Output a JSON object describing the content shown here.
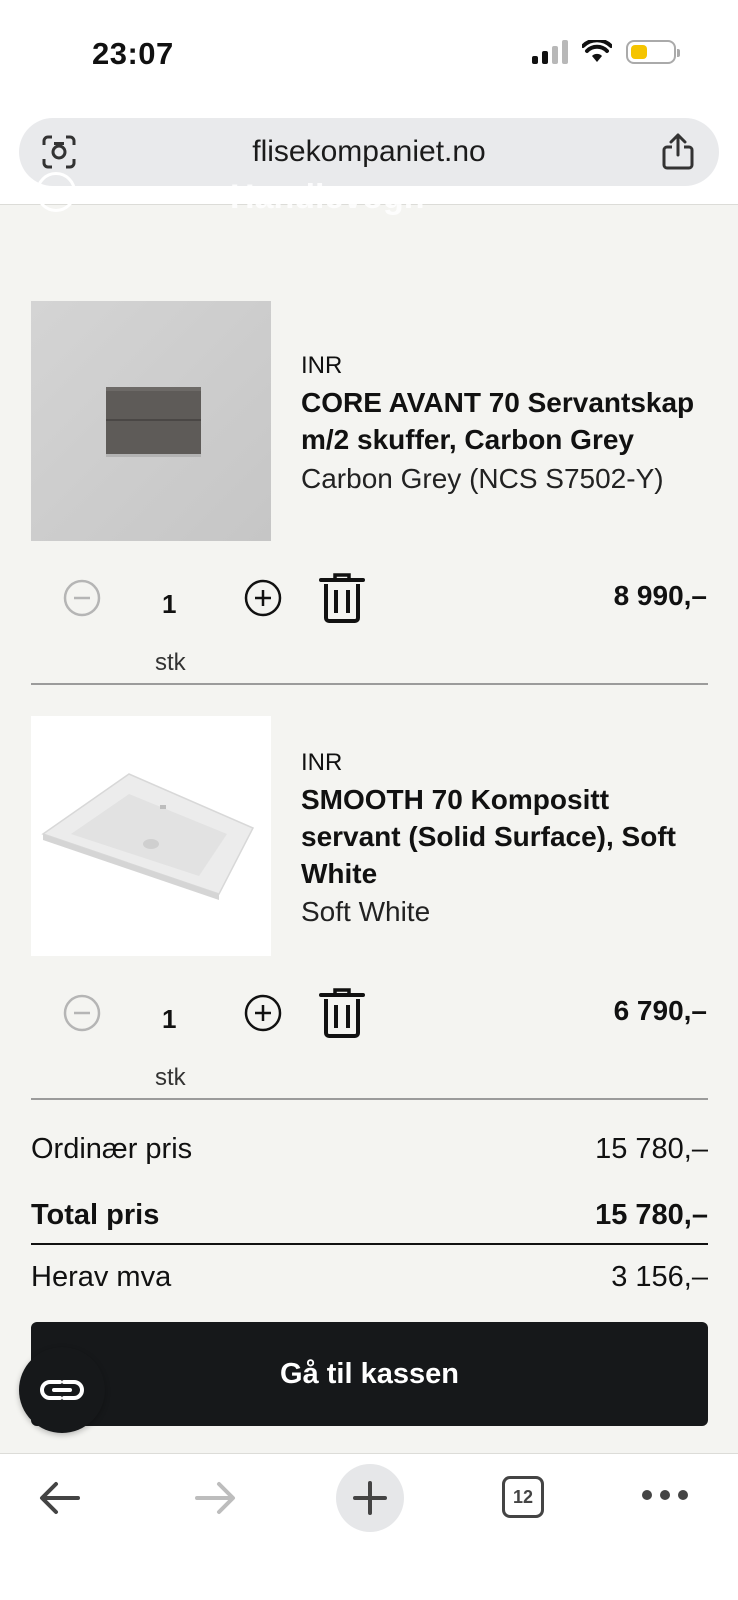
{
  "status_bar": {
    "time": "23:07"
  },
  "browser": {
    "url": "flisekompaniet.no",
    "tab_count": "12"
  },
  "page": {
    "header_ghost": "Handlevogn"
  },
  "cart": {
    "items": [
      {
        "brand": "INR",
        "name": "CORE AVANT 70 Servantskap m/2 skuffer, Carbon Grey",
        "variant": "Carbon Grey (NCS S7502-Y)",
        "quantity": "1",
        "unit": "stk",
        "price": "8 990,–"
      },
      {
        "brand": "INR",
        "name": "SMOOTH 70 Kompositt servant (Solid Surface), Soft White",
        "variant": "Soft White",
        "quantity": "1",
        "unit": "stk",
        "price": "6 790,–"
      }
    ]
  },
  "summary": {
    "ordinary_label": "Ordinær pris",
    "ordinary_value": "15 780,–",
    "total_label": "Total pris",
    "total_value": "15 780,–",
    "vat_label": "Herav mva",
    "vat_value": "3 156,–"
  },
  "checkout": {
    "label": "Gå til kassen"
  },
  "colors": {
    "background": "#f4f4f1",
    "button": "#16181a",
    "battery": "#f5c400"
  }
}
